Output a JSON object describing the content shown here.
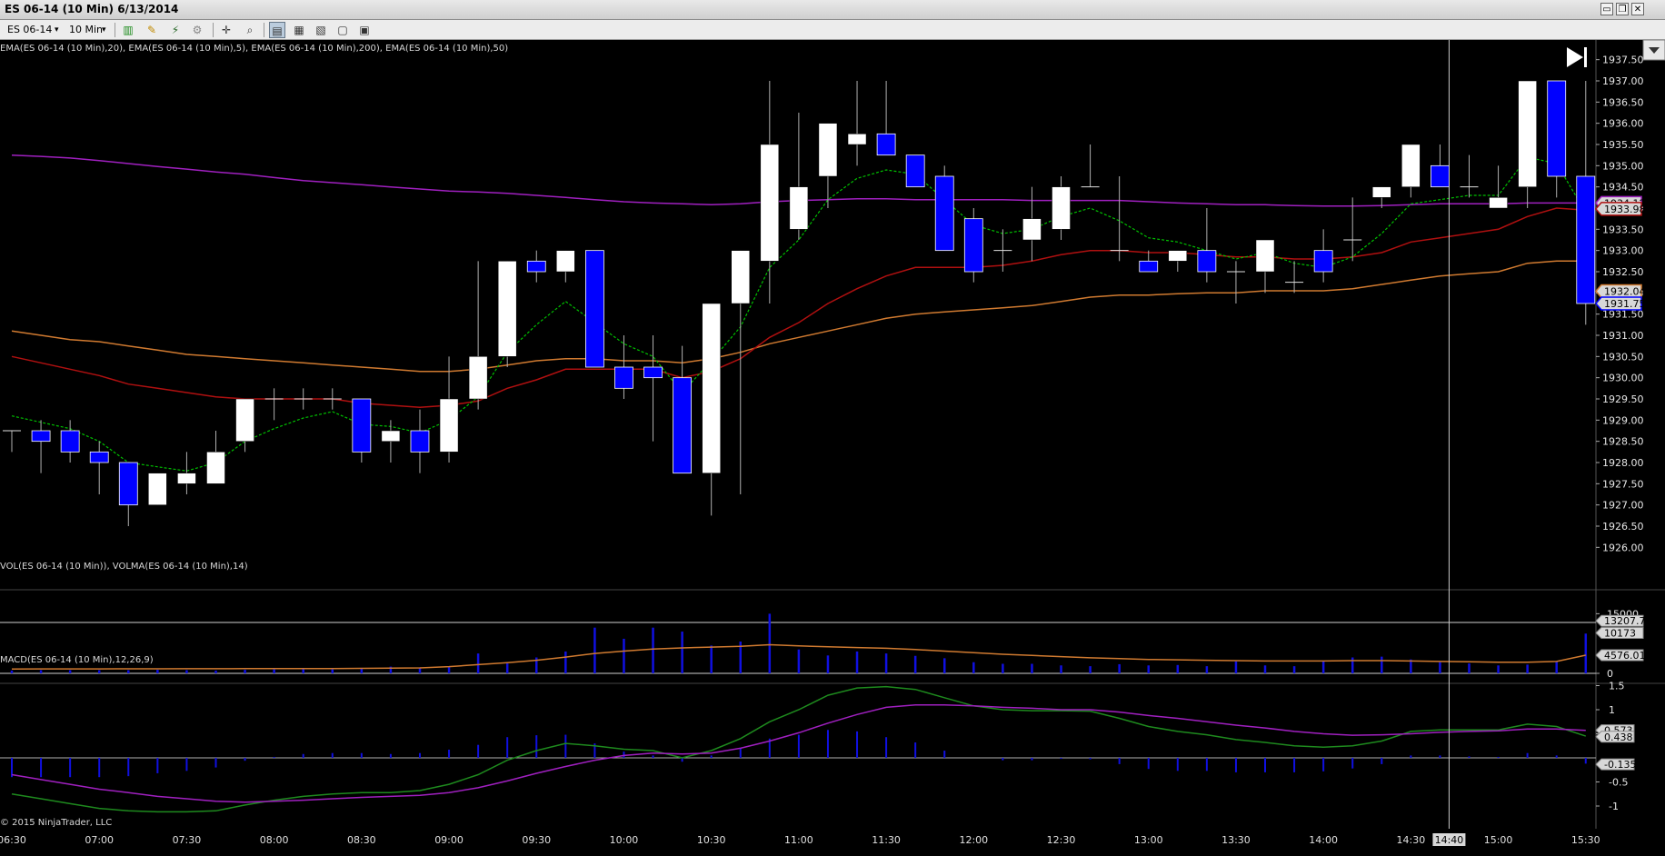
{
  "window": {
    "title": "ES 06-14 (10 Min)  6/13/2014",
    "buttons": [
      "▭",
      "❐",
      "✕"
    ]
  },
  "toolbar": {
    "instrument": "ES 06-14",
    "interval": "10 Min",
    "icons": [
      "bar-type-icon",
      "draw-pen-icon",
      "indicators-icon",
      "strategies-icon",
      "crosshair-icon",
      "zoom-icon",
      "data-box-icon",
      "chart-trader-icon",
      "properties-icon",
      "print-icon",
      "layout-icon"
    ]
  },
  "colors": {
    "background": "#000000",
    "up_candle": "#ffffff",
    "down_candle": "#0000ff",
    "ema_fast": "#00c000",
    "ema_20": "#b01010",
    "ema_50": "#d07a30",
    "ema_200": "#a020c0",
    "volume": "#1010e0",
    "volma": "#d07a30",
    "macd": "#1e8a1e",
    "macd_signal": "#a020c0"
  },
  "chart_data": [
    {
      "type": "candlestick",
      "title": "EMA(ES 06-14 (10 Min),20), EMA(ES 06-14 (10 Min),5), EMA(ES 06-14 (10 Min),200), EMA(ES 06-14 (10 Min),50)",
      "ylim": [
        1925.75,
        1937.75
      ],
      "yticks": [
        "1937.50",
        "1937.00",
        "1936.50",
        "1936.00",
        "1935.50",
        "1935.00",
        "1934.50",
        "1934.00",
        "1933.50",
        "1933.00",
        "1932.50",
        "1932.00",
        "1931.50",
        "1931.00",
        "1930.50",
        "1930.00",
        "1929.50",
        "1929.00",
        "1928.50",
        "1928.00",
        "1927.50",
        "1927.00",
        "1926.50",
        "1926.00"
      ],
      "x": [
        "06:30",
        "06:40",
        "06:50",
        "07:00",
        "07:10",
        "07:20",
        "07:30",
        "07:40",
        "07:50",
        "08:00",
        "08:10",
        "08:20",
        "08:30",
        "08:40",
        "08:50",
        "09:00",
        "09:10",
        "09:20",
        "09:30",
        "09:40",
        "09:50",
        "10:00",
        "10:10",
        "10:20",
        "10:30",
        "10:40",
        "10:50",
        "11:00",
        "11:10",
        "11:20",
        "11:30",
        "11:40",
        "11:50",
        "12:00",
        "12:10",
        "12:20",
        "12:30",
        "12:40",
        "12:50",
        "13:00",
        "13:10",
        "13:20",
        "13:30",
        "13:40",
        "13:50",
        "14:00",
        "14:10",
        "14:20",
        "14:30",
        "14:40",
        "14:50",
        "15:00",
        "15:10",
        "15:20",
        "15:30"
      ],
      "xticks": [
        "06:30",
        "07:00",
        "07:30",
        "08:00",
        "08:30",
        "09:00",
        "09:30",
        "10:00",
        "10:30",
        "11:00",
        "11:30",
        "12:00",
        "12:30",
        "13:00",
        "13:30",
        "14:00",
        "14:30",
        "15:00",
        "15:30"
      ],
      "open": [
        1928.75,
        1928.75,
        1928.75,
        1928.25,
        1928.0,
        1927.0,
        1927.5,
        1927.5,
        1928.5,
        1929.5,
        1929.5,
        1929.5,
        1929.5,
        1928.5,
        1928.75,
        1928.25,
        1929.5,
        1930.5,
        1932.75,
        1932.5,
        1933.0,
        1930.25,
        1930.25,
        1930.0,
        1927.75,
        1931.75,
        1932.75,
        1933.5,
        1934.75,
        1935.5,
        1935.75,
        1935.25,
        1934.75,
        1933.75,
        1933.0,
        1933.25,
        1933.5,
        1934.5,
        1933.0,
        1932.75,
        1932.75,
        1933.0,
        1932.5,
        1932.5,
        1932.25,
        1933.0,
        1933.25,
        1934.25,
        1934.5,
        1935.0,
        1934.5,
        1934.0,
        1934.5,
        1937.0,
        1934.75
      ],
      "high": [
        1928.75,
        1929.0,
        1929.0,
        1928.5,
        1928.0,
        1927.75,
        1928.25,
        1928.75,
        1929.5,
        1929.75,
        1929.75,
        1929.75,
        1929.5,
        1929.0,
        1929.25,
        1930.5,
        1932.75,
        1932.75,
        1933.0,
        1933.0,
        1933.0,
        1931.0,
        1931.0,
        1930.75,
        1931.0,
        1933.0,
        1937.0,
        1936.25,
        1936.0,
        1937.0,
        1937.0,
        1935.25,
        1935.0,
        1934.0,
        1933.5,
        1934.5,
        1934.75,
        1935.5,
        1934.75,
        1933.0,
        1933.0,
        1934.0,
        1932.75,
        1933.0,
        1932.75,
        1933.5,
        1934.25,
        1934.5,
        1935.5,
        1935.5,
        1935.25,
        1935.0,
        1935.0,
        1937.0,
        1937.0
      ],
      "low": [
        1928.25,
        1927.75,
        1928.0,
        1927.25,
        1926.5,
        1927.0,
        1927.25,
        1927.5,
        1928.25,
        1929.0,
        1929.25,
        1929.25,
        1928.0,
        1928.0,
        1927.75,
        1928.0,
        1929.25,
        1930.25,
        1932.25,
        1932.25,
        1931.0,
        1929.5,
        1928.5,
        1928.0,
        1926.75,
        1927.25,
        1931.75,
        1933.25,
        1934.0,
        1935.0,
        1935.25,
        1934.5,
        1933.0,
        1932.25,
        1932.5,
        1932.75,
        1933.25,
        1934.5,
        1932.75,
        1932.5,
        1932.5,
        1932.25,
        1931.75,
        1932.0,
        1932.0,
        1932.25,
        1932.75,
        1934.0,
        1934.25,
        1934.5,
        1934.25,
        1934.25,
        1934.0,
        1934.25,
        1931.25
      ],
      "close": [
        1928.75,
        1928.5,
        1928.25,
        1928.0,
        1927.0,
        1927.75,
        1927.75,
        1928.25,
        1929.5,
        1929.5,
        1929.5,
        1929.5,
        1928.25,
        1928.75,
        1928.25,
        1929.5,
        1930.5,
        1932.75,
        1932.5,
        1933.0,
        1930.25,
        1929.75,
        1930.0,
        1927.75,
        1931.75,
        1933.0,
        1935.5,
        1934.5,
        1936.0,
        1935.75,
        1935.25,
        1934.5,
        1933.0,
        1932.5,
        1933.0,
        1933.75,
        1934.5,
        1934.5,
        1933.0,
        1932.5,
        1933.0,
        1932.5,
        1932.5,
        1933.25,
        1932.25,
        1932.5,
        1933.25,
        1934.5,
        1935.5,
        1934.5,
        1934.5,
        1934.25,
        1937.0,
        1934.75,
        1931.75
      ],
      "series": [
        {
          "name": "EMA(ES 06-14 (10 Min),5)",
          "values": [
            1929.1,
            1928.95,
            1928.8,
            1928.5,
            1928.0,
            1927.9,
            1927.8,
            1928.0,
            1928.5,
            1928.8,
            1929.05,
            1929.2,
            1928.9,
            1928.85,
            1928.7,
            1929.0,
            1929.55,
            1930.6,
            1931.25,
            1931.8,
            1931.3,
            1930.8,
            1930.5,
            1929.65,
            1930.4,
            1931.2,
            1932.6,
            1933.25,
            1934.2,
            1934.7,
            1934.9,
            1934.8,
            1934.2,
            1933.6,
            1933.4,
            1933.5,
            1933.8,
            1934.0,
            1933.7,
            1933.3,
            1933.2,
            1933.0,
            1932.8,
            1932.95,
            1932.7,
            1932.6,
            1932.85,
            1933.4,
            1934.1,
            1934.2,
            1934.3,
            1934.3,
            1935.2,
            1935.05,
            1933.9
          ]
        },
        {
          "name": "EMA(ES 06-14 (10 Min),20)",
          "values": [
            1930.5,
            1930.35,
            1930.2,
            1930.05,
            1929.85,
            1929.75,
            1929.65,
            1929.55,
            1929.5,
            1929.5,
            1929.5,
            1929.5,
            1929.4,
            1929.35,
            1929.3,
            1929.35,
            1929.45,
            1929.75,
            1929.95,
            1930.2,
            1930.2,
            1930.2,
            1930.2,
            1930.0,
            1930.15,
            1930.45,
            1930.95,
            1931.3,
            1931.75,
            1932.1,
            1932.4,
            1932.6,
            1932.6,
            1932.6,
            1932.65,
            1932.75,
            1932.9,
            1933.0,
            1933.0,
            1932.95,
            1932.95,
            1932.9,
            1932.85,
            1932.85,
            1932.8,
            1932.8,
            1932.85,
            1932.95,
            1933.2,
            1933.3,
            1933.4,
            1933.5,
            1933.8,
            1934.0,
            1933.95
          ]
        },
        {
          "name": "EMA(ES 06-14 (10 Min),50)",
          "values": [
            1931.1,
            1931.0,
            1930.9,
            1930.85,
            1930.75,
            1930.65,
            1930.55,
            1930.5,
            1930.45,
            1930.4,
            1930.35,
            1930.3,
            1930.25,
            1930.2,
            1930.15,
            1930.15,
            1930.2,
            1930.3,
            1930.4,
            1930.45,
            1930.45,
            1930.4,
            1930.4,
            1930.35,
            1930.45,
            1930.6,
            1930.8,
            1930.95,
            1931.1,
            1931.25,
            1931.4,
            1931.5,
            1931.55,
            1931.6,
            1931.65,
            1931.7,
            1931.8,
            1931.9,
            1931.95,
            1931.95,
            1931.98,
            1932.0,
            1932.0,
            1932.05,
            1932.05,
            1932.05,
            1932.1,
            1932.2,
            1932.3,
            1932.4,
            1932.45,
            1932.5,
            1932.7,
            1932.75,
            1932.75
          ]
        },
        {
          "name": "EMA(ES 06-14 (10 Min),200)",
          "values": [
            1935.25,
            1935.22,
            1935.18,
            1935.12,
            1935.05,
            1934.98,
            1934.92,
            1934.85,
            1934.8,
            1934.72,
            1934.65,
            1934.6,
            1934.55,
            1934.5,
            1934.45,
            1934.4,
            1934.38,
            1934.35,
            1934.3,
            1934.25,
            1934.2,
            1934.15,
            1934.12,
            1934.1,
            1934.08,
            1934.1,
            1934.15,
            1934.18,
            1934.2,
            1934.22,
            1934.22,
            1934.2,
            1934.2,
            1934.2,
            1934.2,
            1934.18,
            1934.18,
            1934.18,
            1934.18,
            1934.15,
            1934.12,
            1934.1,
            1934.08,
            1934.08,
            1934.06,
            1934.05,
            1934.05,
            1934.06,
            1934.08,
            1934.1,
            1934.1,
            1934.1,
            1934.12,
            1934.12,
            1934.12
          ]
        }
      ],
      "price_tags": [
        {
          "label": "1934.12",
          "value": 1934.12,
          "color": "#a020c0"
        },
        {
          "label": "1933.98",
          "value": 1933.98,
          "color": "#b01010"
        },
        {
          "label": "1932.04",
          "value": 1932.04,
          "color": "#d07a30"
        },
        {
          "label": "1931.75",
          "value": 1931.75,
          "color": "#0000ff"
        }
      ],
      "crosshair": {
        "x_label": "14:40"
      }
    },
    {
      "type": "bar",
      "title": "VOL(ES 06-14 (10 Min)), VOLMA(ES 06-14 (10 Min),14)",
      "ylim": [
        0,
        16000
      ],
      "yticks": [
        "15000",
        "0"
      ],
      "series": [
        {
          "name": "VOL(ES 06-14 (10 Min))",
          "values": [
            700,
            800,
            800,
            800,
            800,
            900,
            800,
            700,
            900,
            1000,
            1100,
            1000,
            1200,
            1700,
            1400,
            1700,
            5000,
            2500,
            4000,
            5500,
            11500,
            8700,
            11500,
            10500,
            7000,
            8000,
            15000,
            6000,
            4500,
            5500,
            5000,
            4400,
            3800,
            2800,
            2400,
            2400,
            2000,
            1800,
            2300,
            2000,
            2100,
            1800,
            3000,
            2000,
            1800,
            3000,
            4000,
            4200,
            3500,
            2800,
            2500,
            2000,
            2200,
            3000,
            10000
          ]
        },
        {
          "name": "VOLMA(ES 06-14 (10 Min),14)",
          "values": [
            1100,
            1110,
            1120,
            1130,
            1140,
            1150,
            1160,
            1170,
            1180,
            1190,
            1200,
            1220,
            1250,
            1300,
            1380,
            1700,
            2200,
            2700,
            3300,
            4100,
            5000,
            5600,
            6100,
            6400,
            6600,
            6800,
            7200,
            6900,
            6700,
            6500,
            6300,
            6000,
            5600,
            5200,
            4800,
            4500,
            4200,
            3900,
            3700,
            3500,
            3400,
            3300,
            3200,
            3100,
            3100,
            3100,
            3200,
            3200,
            3100,
            3000,
            2900,
            2800,
            2800,
            3000,
            4576
          ]
        }
      ],
      "value_tags": [
        {
          "label": "13207.78",
          "value": 13207.78,
          "color": "#dddddd"
        },
        {
          "label": "10173",
          "value": 10173,
          "color": "#dddddd"
        },
        {
          "label": "4576.01",
          "value": 4576.01,
          "color": "#dddddd"
        }
      ]
    },
    {
      "type": "line",
      "title": "MACD(ES 06-14 (10 Min),12,26,9)",
      "ylim": [
        -1.25,
        1.75
      ],
      "yticks": [
        "1.5",
        "1",
        "0.5",
        "-0.5",
        "-1"
      ],
      "series": [
        {
          "name": "MACD",
          "values": [
            -0.75,
            -0.85,
            -0.95,
            -1.05,
            -1.1,
            -1.12,
            -1.12,
            -1.1,
            -0.98,
            -0.88,
            -0.8,
            -0.75,
            -0.72,
            -0.72,
            -0.68,
            -0.55,
            -0.35,
            -0.05,
            0.15,
            0.3,
            0.25,
            0.18,
            0.15,
            0.0,
            0.15,
            0.4,
            0.75,
            1.0,
            1.3,
            1.45,
            1.48,
            1.42,
            1.25,
            1.08,
            1.0,
            0.98,
            0.98,
            0.97,
            0.82,
            0.65,
            0.55,
            0.48,
            0.38,
            0.32,
            0.25,
            0.22,
            0.25,
            0.35,
            0.55,
            0.58,
            0.58,
            0.58,
            0.7,
            0.65,
            0.45
          ]
        },
        {
          "name": "Avg",
          "values": [
            -0.35,
            -0.45,
            -0.55,
            -0.65,
            -0.72,
            -0.8,
            -0.85,
            -0.9,
            -0.92,
            -0.9,
            -0.88,
            -0.85,
            -0.82,
            -0.8,
            -0.78,
            -0.72,
            -0.62,
            -0.48,
            -0.32,
            -0.18,
            -0.05,
            0.05,
            0.1,
            0.08,
            0.1,
            0.2,
            0.35,
            0.52,
            0.72,
            0.9,
            1.05,
            1.1,
            1.1,
            1.08,
            1.05,
            1.03,
            1.0,
            1.0,
            0.95,
            0.88,
            0.82,
            0.75,
            0.68,
            0.62,
            0.55,
            0.5,
            0.47,
            0.48,
            0.5,
            0.53,
            0.55,
            0.56,
            0.6,
            0.6,
            0.57
          ]
        },
        {
          "name": "Diff",
          "values": [
            -0.4,
            -0.4,
            -0.4,
            -0.4,
            -0.38,
            -0.32,
            -0.27,
            -0.2,
            -0.06,
            0.02,
            0.08,
            0.1,
            0.1,
            0.08,
            0.1,
            0.17,
            0.27,
            0.43,
            0.47,
            0.48,
            0.3,
            0.13,
            0.05,
            -0.08,
            0.05,
            0.2,
            0.4,
            0.48,
            0.58,
            0.55,
            0.43,
            0.32,
            0.15,
            0.0,
            -0.05,
            -0.05,
            -0.02,
            -0.03,
            -0.13,
            -0.23,
            -0.27,
            -0.27,
            -0.3,
            -0.3,
            -0.3,
            -0.28,
            -0.22,
            -0.13,
            0.05,
            0.05,
            0.03,
            0.02,
            0.1,
            0.05,
            -0.12
          ]
        }
      ],
      "value_tags": [
        {
          "label": "0.573",
          "value": 0.573,
          "color": "#dddddd"
        },
        {
          "label": "0.438",
          "value": 0.438,
          "color": "#dddddd"
        },
        {
          "label": "-0.135",
          "value": -0.135,
          "color": "#dddddd"
        }
      ]
    }
  ],
  "footer": {
    "copyright": "© 2015 NinjaTrader, LLC"
  }
}
